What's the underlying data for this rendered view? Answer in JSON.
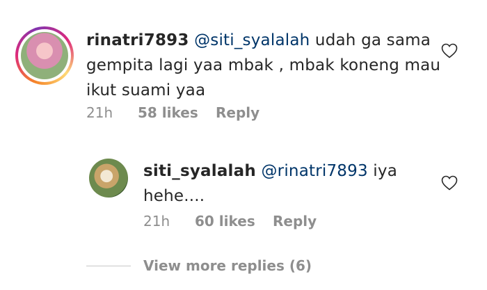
{
  "comments": [
    {
      "username": "rinatri7893",
      "mention": "@siti_syalalah",
      "text_line1": " udah ga sama",
      "text_line2": "gempita lagi yaa mbak , mbak koneng mau",
      "text_line3": "ikut suami yaa",
      "time": "21h",
      "likes": "58 likes",
      "reply_label": "Reply"
    },
    {
      "username": "siti_syalalah",
      "mention": "@rinatri7893",
      "text_line1": " iya",
      "text_line2": "hehe....",
      "time": "21h",
      "likes": "60 likes",
      "reply_label": "Reply"
    }
  ],
  "view_more_label": "View more replies (6)",
  "colors": {
    "mention": "#003569",
    "meta": "#8e8e8e",
    "text": "#262626"
  }
}
